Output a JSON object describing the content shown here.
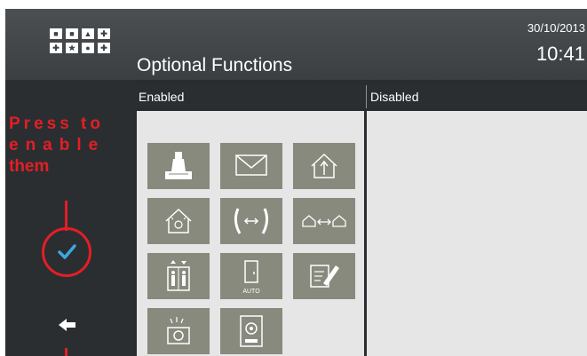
{
  "header": {
    "title": "Optional Functions",
    "date": "30/10/2013",
    "time": "10:41",
    "logo_symbols": [
      "■",
      "■",
      "▲",
      "✚",
      "✚",
      "★",
      "●",
      "✚"
    ]
  },
  "columns": {
    "enabled_label": "Enabled",
    "disabled_label": "Disabled"
  },
  "enabled_functions": [
    {
      "icon": "concierge-icon"
    },
    {
      "icon": "message-icon"
    },
    {
      "icon": "home-arrival-icon"
    },
    {
      "icon": "home-alarm-icon"
    },
    {
      "icon": "call-transfer-icon"
    },
    {
      "icon": "home-to-home-icon"
    },
    {
      "icon": "lift-icon"
    },
    {
      "icon": "door-auto-icon",
      "caption": "AUTO"
    },
    {
      "icon": "notes-icon"
    },
    {
      "icon": "camera-icon"
    },
    {
      "icon": "intercom-panel-icon"
    }
  ],
  "annotation": {
    "line1": "Press to",
    "line2": "enable",
    "line3": "them",
    "color": "#e41e26"
  },
  "colors": {
    "tile": "#878a7d",
    "panel": "#e6e6e6",
    "check": "#3aa8e0"
  }
}
